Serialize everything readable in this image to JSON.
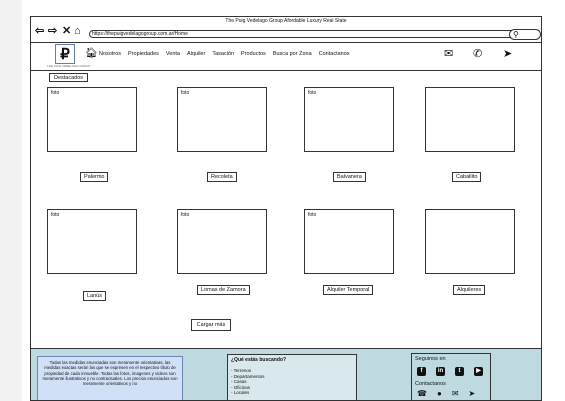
{
  "window": {
    "title": "The Puig Vedelago Group Afordable Luxury Real State",
    "url": "https://thepuigvedelagogroup.com.ar/Home"
  },
  "logo": {
    "glyph": "₽",
    "tagline": "THE PUIG VEDELAGO GROUP"
  },
  "nav": {
    "items": [
      "Nosotros",
      "Propiedades",
      "Venta",
      "Alquiler",
      "Tasación",
      "Productos",
      "Busca por Zona",
      "Contactanos"
    ]
  },
  "gallery": {
    "featured_label": "Destacados",
    "photo_placeholder": "foto",
    "cards": [
      {
        "label": "Palermo",
        "show_foto": true
      },
      {
        "label": "Recoleta",
        "show_foto": true
      },
      {
        "label": "Balvanera",
        "show_foto": true
      },
      {
        "label": "Caballito",
        "show_foto": false
      },
      {
        "label": "Lanús",
        "show_foto": true
      },
      {
        "label": "Lomas de Zamora",
        "show_foto": true
      },
      {
        "label": "Alquiler Temporal",
        "show_foto": true
      },
      {
        "label": "Alquileres",
        "show_foto": false
      }
    ],
    "load_more": "Cargar más"
  },
  "footer": {
    "disclaimer": "Todas las medidas enunciadas son meramente orientativas, las medidas exactas serán las que se expresen en el respectivo título de propiedad de cada inmueble. Todas las fotos, imagenes y videos son meramente ilustrativos y no contractuales. Los precios enunciados son meramente orientativos y no",
    "looking_title": "¿Qué estás buscando?",
    "looking_items": [
      "- Terrenos",
      "- Departamentos",
      "- Casas",
      "- Oficinas",
      "- Locales"
    ],
    "follow_label": "Seguinos en",
    "contact_label": "Contactanos"
  }
}
